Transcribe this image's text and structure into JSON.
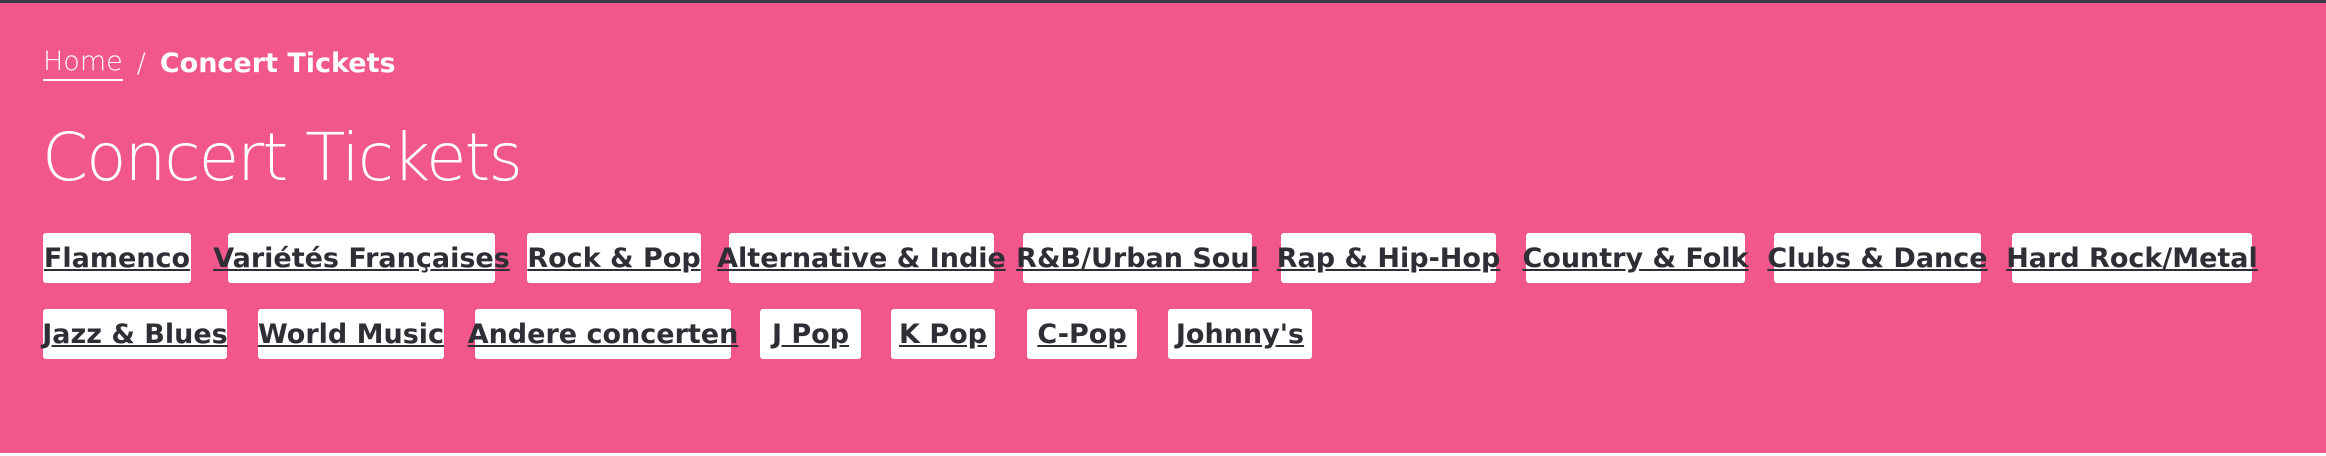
{
  "breadcrumb": {
    "home_label": "Home",
    "separator": "/",
    "current_label": "Concert Tickets"
  },
  "page_title": "Concert Tickets",
  "categories": [
    "Flamenco",
    "Variétés Françaises",
    "Rock & Pop",
    "Alternative & Indie",
    "R&B/Urban Soul",
    "Rap & Hip-Hop",
    "Country & Folk",
    "Clubs & Dance",
    "Hard Rock/Metal",
    "Jazz & Blues",
    "World Music",
    "Andere concerten",
    "J Pop",
    "K Pop",
    "C-Pop",
    "Johnny's"
  ],
  "colors": {
    "banner_background": "#f2578c",
    "tag_background": "#ffffff",
    "tag_text": "#2e2e34",
    "top_border": "#3a3a44"
  }
}
